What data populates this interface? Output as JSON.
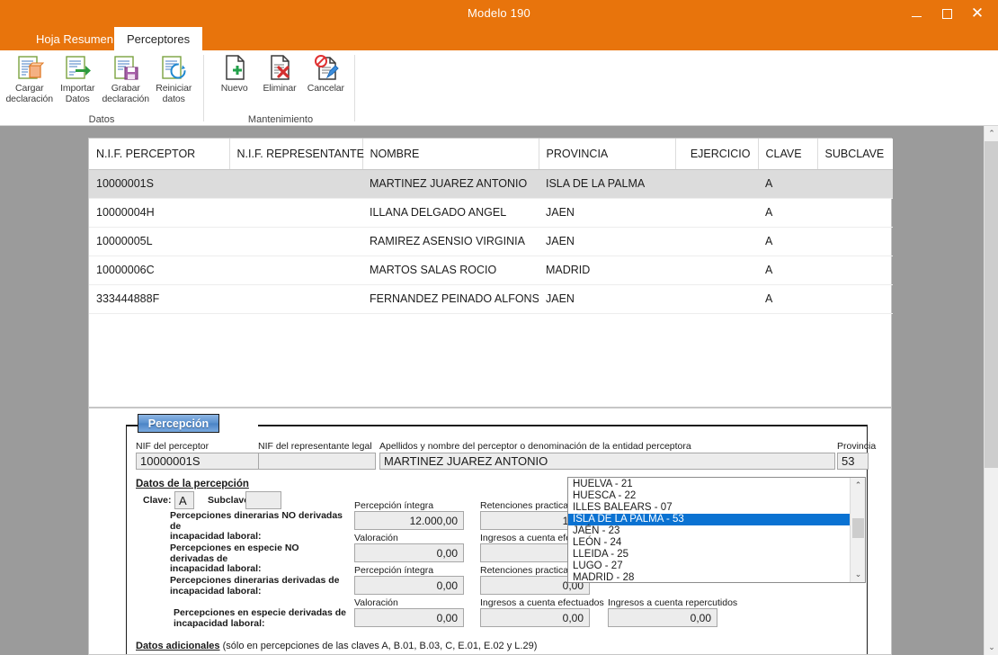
{
  "window": {
    "title": "Modelo 190",
    "minimize_label": "Minimizar",
    "maximize_label": "Maximizar",
    "close_label": "Cerrar",
    "accent_color": "#e8740c"
  },
  "tabs": [
    {
      "label": "Hoja Resumen",
      "active": false
    },
    {
      "label": "Perceptores",
      "active": true
    }
  ],
  "ribbon": {
    "groups": [
      {
        "name": "Datos",
        "buttons": [
          {
            "label": "Cargar\ndeclaración",
            "icon": "load-document-icon"
          },
          {
            "label": "Importar\nDatos",
            "icon": "import-arrow-icon"
          },
          {
            "label": "Grabar\ndeclaración",
            "icon": "save-floppy-icon"
          },
          {
            "label": "Reiniciar\ndatos",
            "icon": "refresh-circular-icon"
          }
        ]
      },
      {
        "name": "Mantenimiento",
        "buttons": [
          {
            "label": "Nuevo",
            "icon": "new-document-plus-icon"
          },
          {
            "label": "Eliminar",
            "icon": "delete-document-x-icon"
          },
          {
            "label": "Cancelar",
            "icon": "cancel-document-pencil-icon"
          }
        ]
      }
    ]
  },
  "grid": {
    "columns": [
      {
        "label": "N.I.F. PERCEPTOR",
        "align": "left"
      },
      {
        "label": "N.I.F. REPRESENTANTE",
        "align": "left"
      },
      {
        "label": "NOMBRE",
        "align": "left"
      },
      {
        "label": "PROVINCIA",
        "align": "left"
      },
      {
        "label": "EJERCICIO",
        "align": "right"
      },
      {
        "label": "CLAVE",
        "align": "left"
      },
      {
        "label": "SUBCLAVE",
        "align": "left"
      }
    ],
    "rows": [
      {
        "selected": true,
        "cells": [
          "10000001S",
          "",
          "MARTINEZ JUAREZ ANTONIO",
          "ISLA DE LA PALMA",
          "",
          "A",
          ""
        ]
      },
      {
        "selected": false,
        "cells": [
          "10000004H",
          "",
          "ILLANA DELGADO ANGEL",
          "JAEN",
          "",
          "A",
          ""
        ]
      },
      {
        "selected": false,
        "cells": [
          "10000005L",
          "",
          "RAMIREZ ASENSIO VIRGINIA",
          "JAEN",
          "",
          "A",
          ""
        ]
      },
      {
        "selected": false,
        "cells": [
          "10000006C",
          "",
          "MARTOS SALAS ROCIO",
          "MADRID",
          "",
          "A",
          ""
        ]
      },
      {
        "selected": false,
        "cells": [
          "333444888F",
          "",
          "FERNANDEZ PEINADO ALFONSO",
          "JAEN",
          "",
          "A",
          ""
        ]
      }
    ]
  },
  "form": {
    "groupbox_title": "Percepción",
    "nif_perceptor": {
      "label": "NIF del perceptor",
      "value": "10000001S"
    },
    "nif_representante": {
      "label": "NIF del representante legal",
      "value": ""
    },
    "nombre": {
      "label": "Apellidos y nombre del perceptor o denominación de la entidad perceptora",
      "value": "MARTINEZ JUAREZ ANTONIO"
    },
    "provincia": {
      "label": "Provincia",
      "value": "53"
    },
    "section_title": "Datos de la percepción",
    "clave": {
      "label": "Clave:",
      "value": "A"
    },
    "subclave": {
      "label": "Subclave:",
      "value": ""
    },
    "rows": [
      {
        "description": "Percepciones dinerarias NO derivadas de\nincapacidad laboral:",
        "left_label": "Percepción íntegra",
        "left_value": "12.000,00",
        "right_label": "Retenciones practicadas",
        "right_value": "1.61"
      },
      {
        "description": "Percepciones en especie NO derivadas de\nincapacidad laboral:",
        "left_label": "Valoración",
        "left_value": "0,00",
        "right_label": "Ingresos a cuenta efectuados",
        "right_value": ""
      },
      {
        "description": "Percepciones dinerarias derivadas de\nincapacidad laboral:",
        "left_label": "Percepción íntegra",
        "left_value": "0,00",
        "right_label": "Retenciones practicadas",
        "right_value": "0,00"
      },
      {
        "description": "Percepciones en especie derivadas de\nincapacidad laboral:",
        "left_label": "Valoración",
        "left_value": "0,00",
        "right_label": "Ingresos a cuenta efectuados",
        "right_value": "0,00"
      }
    ],
    "extra": {
      "label": "Ingresos a cuenta repercutidos",
      "value": "0,00"
    },
    "footer_bold": "Datos adicionales",
    "footer_rest": " (sólo en percepciones de las claves A, B.01, B.03, C, E.01, E.02 y L.29)"
  },
  "province_dropdown": {
    "options": [
      {
        "label": "HUELVA - 21",
        "selected": false
      },
      {
        "label": "HUESCA - 22",
        "selected": false
      },
      {
        "label": "ILLES BALEARS - 07",
        "selected": false
      },
      {
        "label": "ISLA DE LA PALMA - 53",
        "selected": true
      },
      {
        "label": "JAÉN - 23",
        "selected": false
      },
      {
        "label": "LEÓN - 24",
        "selected": false
      },
      {
        "label": "LLEIDA - 25",
        "selected": false
      },
      {
        "label": "LUGO - 27",
        "selected": false
      },
      {
        "label": "MADRID - 28",
        "selected": false
      }
    ],
    "highlight_color": "#0a72d2",
    "scroll_up_glyph": "⌃",
    "scroll_down_glyph": "⌄"
  },
  "scrollbar": {
    "up_glyph": "⌃",
    "down_glyph": "⌄"
  }
}
